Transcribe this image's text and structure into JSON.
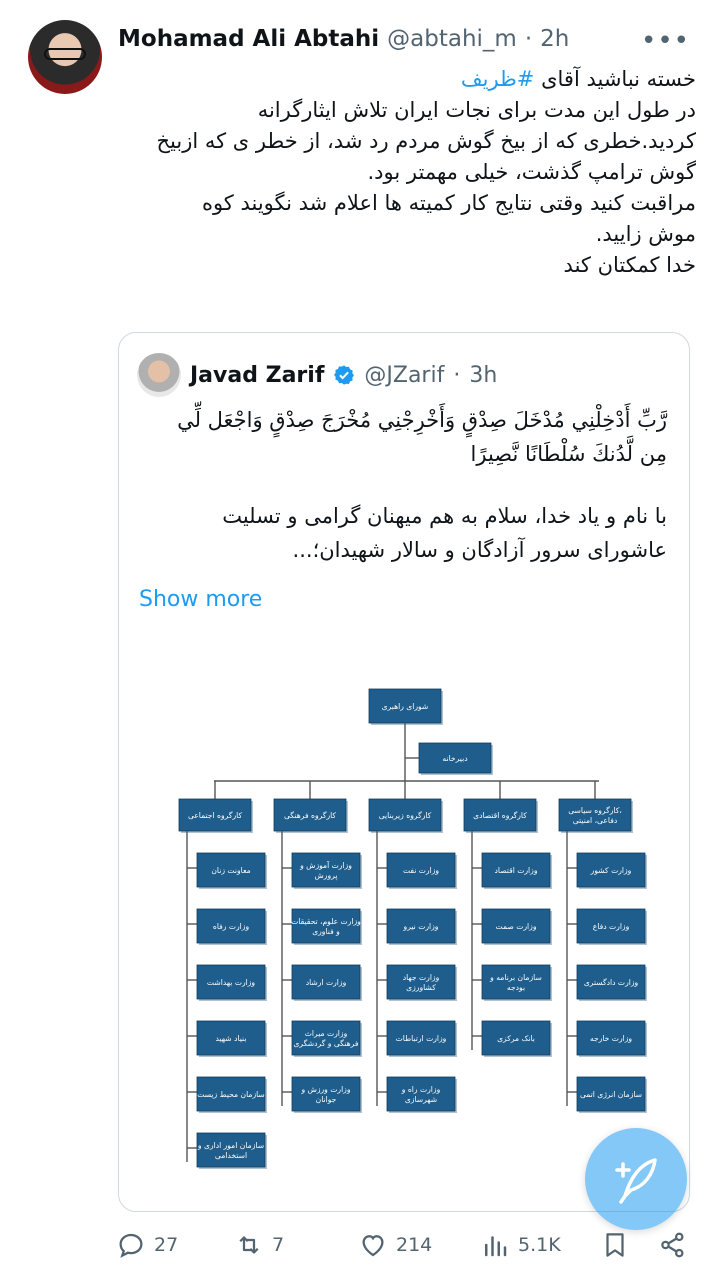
{
  "author": {
    "name": "Mohamad Ali Abtahi",
    "handle": "@abtahi_m",
    "separator": "·",
    "time": "2h",
    "more_icon": "more-horizontal-icon"
  },
  "tweet": {
    "lines": [
      {
        "pre": "خسته نباشید آقای ",
        "tag": "#ظریف"
      },
      {
        "text": "در طول این مدت برای نجات ایران تلاش ایثارگرانه"
      },
      {
        "text": "کردید.خطری که از بیخ گوش مردم رد شد، از خطر ی که ازبیخ"
      },
      {
        "text": "گوش ترامپ گذشت، خیلی مهمتر بود."
      },
      {
        "text": "مراقبت کنید وقتی نتایج کار کمیته ها اعلام شد نگویند کوه"
      },
      {
        "text": "موش زایید."
      },
      {
        "text": "خدا کمکتان کند"
      }
    ]
  },
  "quote": {
    "name": "Javad Zarif",
    "handle": "@JZarif",
    "separator": "·",
    "time": "3h",
    "verified_icon": "verified-badge-icon",
    "verse_lines": [
      "رَّبِّ أَدْخِلْنِي مُدْخَلَ صِدْقٍ وَأَخْرِجْنِي مُخْرَجَ صِدْقٍ وَاجْعَل لِّي",
      "مِن لَّدُنكَ سُلْطَانًا نَّصِيرًا"
    ],
    "body_lines": [
      "با نام و یاد خدا، سلام به هم میهنان گرامی و تسلیت",
      "عاشورای سرور آزادگان و سالار شهیدان؛..."
    ],
    "show_more": "Show more",
    "org_chart": {
      "top": "شورای راهبری",
      "secretariat": "دبیرخانه",
      "columns": [
        {
          "header": "کارگروه اجتماعی",
          "items": [
            "معاونت زنان",
            "وزارت رفاه",
            "وزارت بهداشت",
            "بنیاد شهید",
            "سازمان محیط زیست",
            [
              "سازمان امور اداری و",
              "استخدامی"
            ]
          ]
        },
        {
          "header": "کارگروه فرهنگی",
          "items": [
            [
              "وزارت آموزش و",
              "پرورش"
            ],
            [
              "وزارت علوم، تحقیقات",
              "و فناوری"
            ],
            "وزارت ارشاد",
            [
              "وزارت میراث",
              "فرهنگی و گردشگری"
            ],
            [
              "وزارت ورزش و",
              "جوانان"
            ]
          ]
        },
        {
          "header": "کارگروه زیربنایی",
          "items": [
            "وزارت نفت",
            "وزارت نیرو",
            [
              "وزارت جهاد",
              "کشاورزی"
            ],
            "وزارت ارتباطات",
            [
              "وزارت راه و",
              "شهرسازی"
            ]
          ]
        },
        {
          "header": "کارگروه اقتصادی",
          "items": [
            "وزارت اقتصاد",
            "وزارت صمت",
            [
              "سازمان برنامه و",
              "بودجه"
            ],
            "بانک مرکزی"
          ]
        },
        {
          "header": [
            "کارگروه سیاسی،",
            "دفاعی، امنیتی"
          ],
          "items": [
            "وزارت کشور",
            "وزارت دفاع",
            "وزارت دادگستری",
            "وزارت خارجه",
            "سازمان انرژی اتمی"
          ]
        }
      ]
    }
  },
  "actions": {
    "replies": "27",
    "reposts": "7",
    "likes": "214",
    "views": "5.1K",
    "icons": [
      "reply-icon",
      "repost-icon",
      "like-icon",
      "views-icon",
      "bookmark-icon",
      "share-icon"
    ]
  },
  "fab": {
    "icon": "compose-feather-icon"
  },
  "colors": {
    "accent": "#1d9bf0",
    "box": "#1f5e8c",
    "text": "#0f1419",
    "muted": "#536471"
  }
}
